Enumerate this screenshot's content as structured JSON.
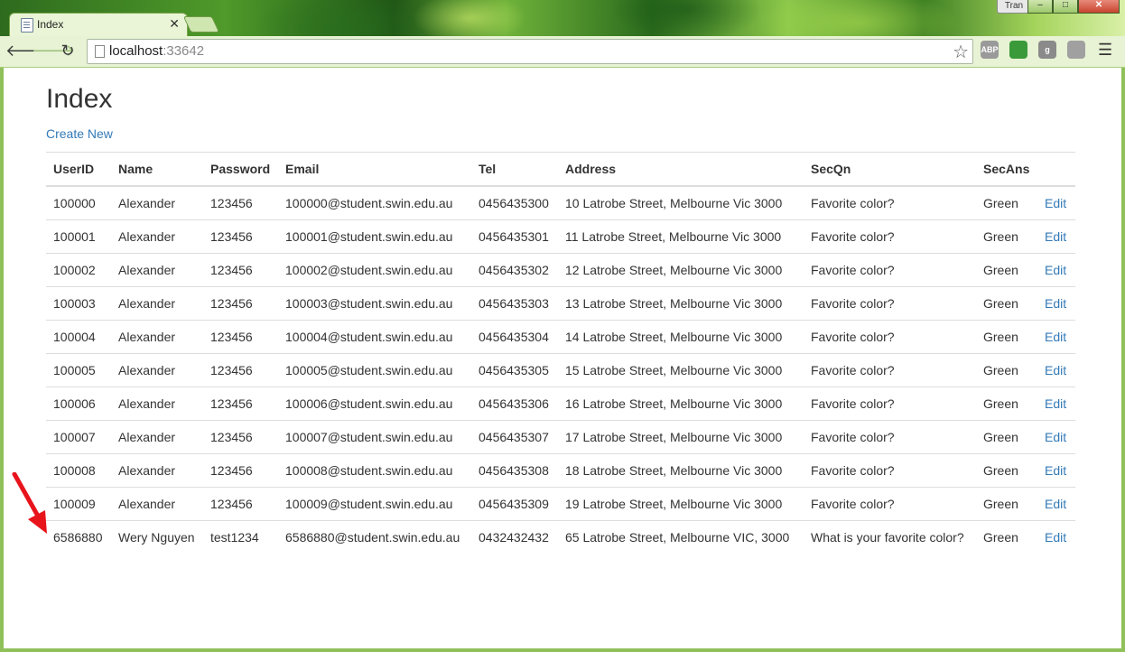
{
  "browser": {
    "tab_title": "Index",
    "tab_close": "✕",
    "url_host": "localhost",
    "url_port": ":33642",
    "user_label": "Tran",
    "extensions": [
      {
        "name": "adblock-icon",
        "label": "ABP",
        "color": "#9a9a9a"
      },
      {
        "name": "bookmark-extension-icon",
        "label": "",
        "color": "#3a9a3a"
      },
      {
        "name": "google-extension-icon",
        "label": "g",
        "color": "#8a8a8a"
      },
      {
        "name": "rss-icon",
        "label": "",
        "color": "#a0a0a0"
      }
    ]
  },
  "page": {
    "title": "Index",
    "create_link": "Create New",
    "columns": [
      "UserID",
      "Name",
      "Password",
      "Email",
      "Tel",
      "Address",
      "SecQn",
      "SecAns"
    ],
    "edit_label": "Edit",
    "rows": [
      [
        "100000",
        "Alexander",
        "123456",
        "100000@student.swin.edu.au",
        "0456435300",
        "10 Latrobe Street, Melbourne Vic 3000",
        "Favorite color?",
        "Green"
      ],
      [
        "100001",
        "Alexander",
        "123456",
        "100001@student.swin.edu.au",
        "0456435301",
        "11 Latrobe Street, Melbourne Vic 3000",
        "Favorite color?",
        "Green"
      ],
      [
        "100002",
        "Alexander",
        "123456",
        "100002@student.swin.edu.au",
        "0456435302",
        "12 Latrobe Street, Melbourne Vic 3000",
        "Favorite color?",
        "Green"
      ],
      [
        "100003",
        "Alexander",
        "123456",
        "100003@student.swin.edu.au",
        "0456435303",
        "13 Latrobe Street, Melbourne Vic 3000",
        "Favorite color?",
        "Green"
      ],
      [
        "100004",
        "Alexander",
        "123456",
        "100004@student.swin.edu.au",
        "0456435304",
        "14 Latrobe Street, Melbourne Vic 3000",
        "Favorite color?",
        "Green"
      ],
      [
        "100005",
        "Alexander",
        "123456",
        "100005@student.swin.edu.au",
        "0456435305",
        "15 Latrobe Street, Melbourne Vic 3000",
        "Favorite color?",
        "Green"
      ],
      [
        "100006",
        "Alexander",
        "123456",
        "100006@student.swin.edu.au",
        "0456435306",
        "16 Latrobe Street, Melbourne Vic 3000",
        "Favorite color?",
        "Green"
      ],
      [
        "100007",
        "Alexander",
        "123456",
        "100007@student.swin.edu.au",
        "0456435307",
        "17 Latrobe Street, Melbourne Vic 3000",
        "Favorite color?",
        "Green"
      ],
      [
        "100008",
        "Alexander",
        "123456",
        "100008@student.swin.edu.au",
        "0456435308",
        "18 Latrobe Street, Melbourne Vic 3000",
        "Favorite color?",
        "Green"
      ],
      [
        "100009",
        "Alexander",
        "123456",
        "100009@student.swin.edu.au",
        "0456435309",
        "19 Latrobe Street, Melbourne Vic 3000",
        "Favorite color?",
        "Green"
      ],
      [
        "6586880",
        "Wery Nguyen",
        "test1234",
        "6586880@student.swin.edu.au",
        "0432432432",
        "65 Latrobe Street, Melbourne VIC, 3000",
        "What is your favorite color?",
        "Green"
      ]
    ]
  },
  "colors": {
    "link": "#337ab7",
    "annotation_arrow": "#e8141c"
  }
}
